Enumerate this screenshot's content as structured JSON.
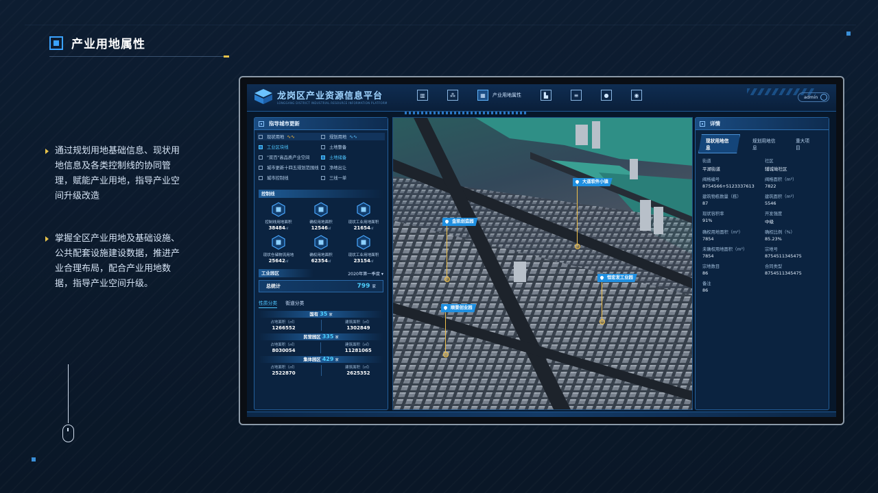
{
  "slide": {
    "title": "产业用地属性",
    "bullets": [
      "通过规划用地基础信息、现状用地信息及各类控制线的协同管理，赋能产业用地，指导产业空间升级改造",
      "掌握全区产业用地及基础设施、公共配套设施建设数据，推进产业合理布局，配合产业用地数据，指导产业空间升级。"
    ]
  },
  "app": {
    "title": "龙岗区产业资源信息平台",
    "subtitle_en": "LONGGANG DISTRICT INDUSTRIAL RESOURCE INFORMATION PLATFORM",
    "nav_active_label": "产业用地属性",
    "user": "admin"
  },
  "left_panel": {
    "title": "指导城市更新",
    "checkboxes": [
      {
        "label": "现状用地",
        "checked": false,
        "head": true,
        "wave": "orange"
      },
      {
        "label": "规划用地",
        "checked": false,
        "head": true,
        "wave": "blue"
      },
      {
        "label": "工业区块线",
        "checked": true
      },
      {
        "label": "土地整备",
        "checked": false
      },
      {
        "label": "\"双百\"高品质产业空间",
        "checked": false
      },
      {
        "label": "土地储备",
        "checked": true
      },
      {
        "label": "城市更新十四五规划范围线",
        "checked": false
      },
      {
        "label": "净地出让",
        "checked": false
      },
      {
        "label": "城市控制线",
        "checked": false
      },
      {
        "label": "三线一单",
        "checked": false
      }
    ],
    "control_title": "控制线",
    "control_items": [
      {
        "label": "控制线用地面积",
        "value": "38484",
        "unit": "㎡"
      },
      {
        "label": "确权用地面积",
        "value": "12546",
        "unit": "㎡"
      },
      {
        "label": "现状工业用地面积",
        "value": "21654",
        "unit": "㎡"
      },
      {
        "label": "现状仓储物流用地",
        "value": "25642",
        "unit": "㎡"
      },
      {
        "label": "确权用地面积",
        "value": "62354",
        "unit": "㎡"
      },
      {
        "label": "现状工业用地面积",
        "value": "23154",
        "unit": "㎡"
      }
    ],
    "industry_title": "工业园区",
    "quarter": "2020年第一季度 ▾",
    "total_label": "总统计",
    "total_value": "799",
    "total_unit": "家",
    "tab_nature": "性质分类",
    "tab_street": "街道分类",
    "groups": [
      {
        "name": "国有",
        "count": "35",
        "unit": "家",
        "land_label": "占地面积（㎡）",
        "land": "1266552",
        "build_label": "建筑面积（㎡）",
        "build": "1302849"
      },
      {
        "name": "民营园区",
        "count": "335",
        "unit": "家",
        "land_label": "占地面积（㎡）",
        "land": "8030054",
        "build_label": "建筑面积（㎡）",
        "build": "11281065"
      },
      {
        "name": "集体园区",
        "count": "429",
        "unit": "家",
        "land_label": "占地面积（㎡）",
        "land": "2522870",
        "build_label": "建筑面积（㎡）",
        "build": "2625352"
      }
    ]
  },
  "map": {
    "markers": [
      "大道软件小镇",
      "金凯创造园",
      "恒宏发工业园",
      "顺景创业园"
    ]
  },
  "right_panel": {
    "title": "详情",
    "tabs": [
      "现状用地信息",
      "规划用地信息",
      "重大项目"
    ],
    "fields": [
      {
        "k": "街道",
        "v": "平湖街道"
      },
      {
        "k": "社区",
        "v": "辅城坳社区"
      },
      {
        "k": "阀格编号",
        "v": "8754566+5123337613"
      },
      {
        "k": "阀格面积（m²）",
        "v": "7822"
      },
      {
        "k": "建筑物栋数量（栋）",
        "v": "87"
      },
      {
        "k": "建筑面积（m²）",
        "v": "5546"
      },
      {
        "k": "现状容积率",
        "v": "91%"
      },
      {
        "k": "开发强度",
        "v": "中级"
      },
      {
        "k": "确权用地面积（m²）",
        "v": "7854"
      },
      {
        "k": "确权比例（%）",
        "v": "85.23%"
      },
      {
        "k": "未确权用地面积（m²）",
        "v": "7854"
      },
      {
        "k": "宗地号",
        "v": "8754511345475"
      },
      {
        "k": "宗地数目",
        "v": "86"
      },
      {
        "k": "合同类型",
        "v": "8754511345475"
      },
      {
        "k": "备注",
        "v": "86"
      }
    ]
  },
  "colors": {
    "accent": "#3aa2ff",
    "highlight": "#4fc6ff",
    "marker": "#1f8fe0",
    "gold": "#e8c34b"
  }
}
